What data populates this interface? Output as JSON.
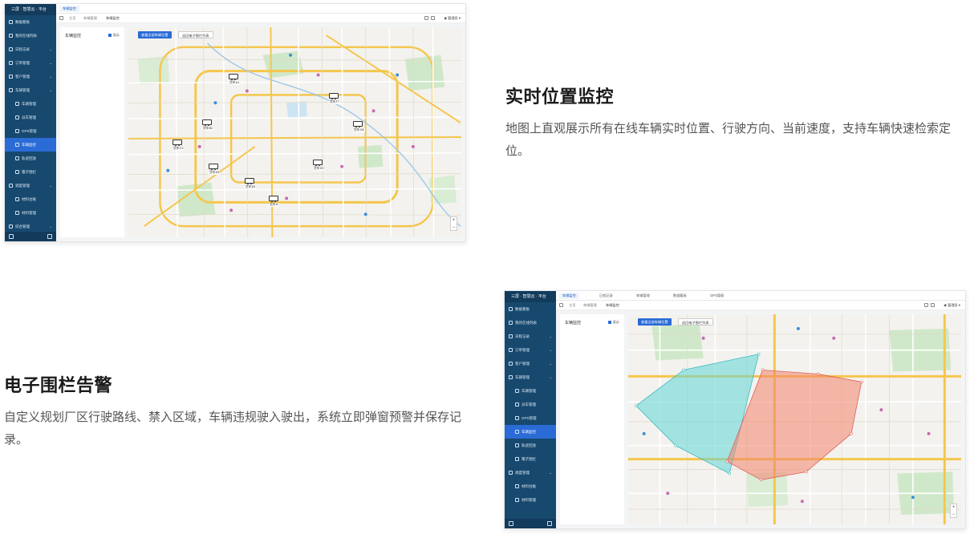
{
  "feature1": {
    "title": "实时位置监控",
    "description": "地图上直观展示所有在线车辆实时位置、行驶方向、当前速度，支持车辆快速检索定位。"
  },
  "feature2": {
    "title": "电子围栏告警",
    "description": "自定义规划厂区行驶路线、禁入区域，车辆违规驶入驶出，系统立即弹窗预警并保存记录。"
  },
  "screenshot1": {
    "brand": "三屏 · 智慧云 · 平台",
    "tabs": [
      "车辆监控"
    ],
    "breadcrumb": [
      "主页",
      "车辆管理",
      "车辆监控"
    ],
    "user": "管理员",
    "menu": [
      {
        "label": "数据看板",
        "type": "item"
      },
      {
        "label": "我的在线列表",
        "type": "item"
      },
      {
        "label": "日程记录",
        "type": "group"
      },
      {
        "label": "订单管理",
        "type": "group"
      },
      {
        "label": "客户管理",
        "type": "group"
      },
      {
        "label": "车辆管理",
        "type": "group"
      },
      {
        "label": "车辆管理",
        "type": "sub"
      },
      {
        "label": "派车管理",
        "type": "sub"
      },
      {
        "label": "GPS管理",
        "type": "sub"
      },
      {
        "label": "车辆监控",
        "type": "sub",
        "active": true
      },
      {
        "label": "轨迹回放",
        "type": "sub"
      },
      {
        "label": "電子围栏",
        "type": "sub"
      },
      {
        "label": "调度管理",
        "type": "group"
      },
      {
        "label": "材料台账",
        "type": "sub"
      },
      {
        "label": "材料管理",
        "type": "sub"
      },
      {
        "label": "综合管理",
        "type": "group"
      }
    ],
    "panel_title": "车辆监控",
    "panel_checkbox": "显示",
    "map_buttons": [
      "查看全部车辆位置",
      "返回电子围栏列表"
    ],
    "vehicle_labels": [
      "货车A1",
      "货车B2",
      "货车C3",
      "货车D5",
      "货车E6",
      "货车F7",
      "货车G8",
      "货车H9",
      "货车I0"
    ]
  },
  "screenshot2": {
    "brand": "三屏 · 智慧云 · 平台",
    "tabs": [
      "车辆监控",
      "日程记录",
      "车辆管理",
      "数据看板",
      "GPS管理"
    ],
    "breadcrumb": [
      "主页",
      "车辆管理",
      "车辆监控"
    ],
    "user": "管理员",
    "menu": [
      {
        "label": "数据看板",
        "type": "item"
      },
      {
        "label": "我的在线列表",
        "type": "item"
      },
      {
        "label": "日程记录",
        "type": "group"
      },
      {
        "label": "订单管理",
        "type": "group"
      },
      {
        "label": "客户管理",
        "type": "group"
      },
      {
        "label": "车辆管理",
        "type": "group"
      },
      {
        "label": "车辆管理",
        "type": "sub"
      },
      {
        "label": "派车管理",
        "type": "sub"
      },
      {
        "label": "GPS管理",
        "type": "sub"
      },
      {
        "label": "车辆监控",
        "type": "sub",
        "active": true
      },
      {
        "label": "轨迹回放",
        "type": "sub"
      },
      {
        "label": "電子围栏",
        "type": "sub"
      },
      {
        "label": "调度管理",
        "type": "group"
      },
      {
        "label": "材料台账",
        "type": "sub"
      },
      {
        "label": "材料管理",
        "type": "sub"
      }
    ],
    "panel_title": "车辆监控",
    "panel_checkbox": "显示",
    "map_buttons": [
      "查看全部车辆位置",
      "返回电子围栏列表"
    ]
  },
  "colors": {
    "sidebar": "#17496f",
    "accent": "#2a6bd6",
    "fence_cyan": "#5fd6d6",
    "fence_red": "#f2836b",
    "road_yellow": "#f5c64d",
    "park_green": "#cfe8c9"
  }
}
